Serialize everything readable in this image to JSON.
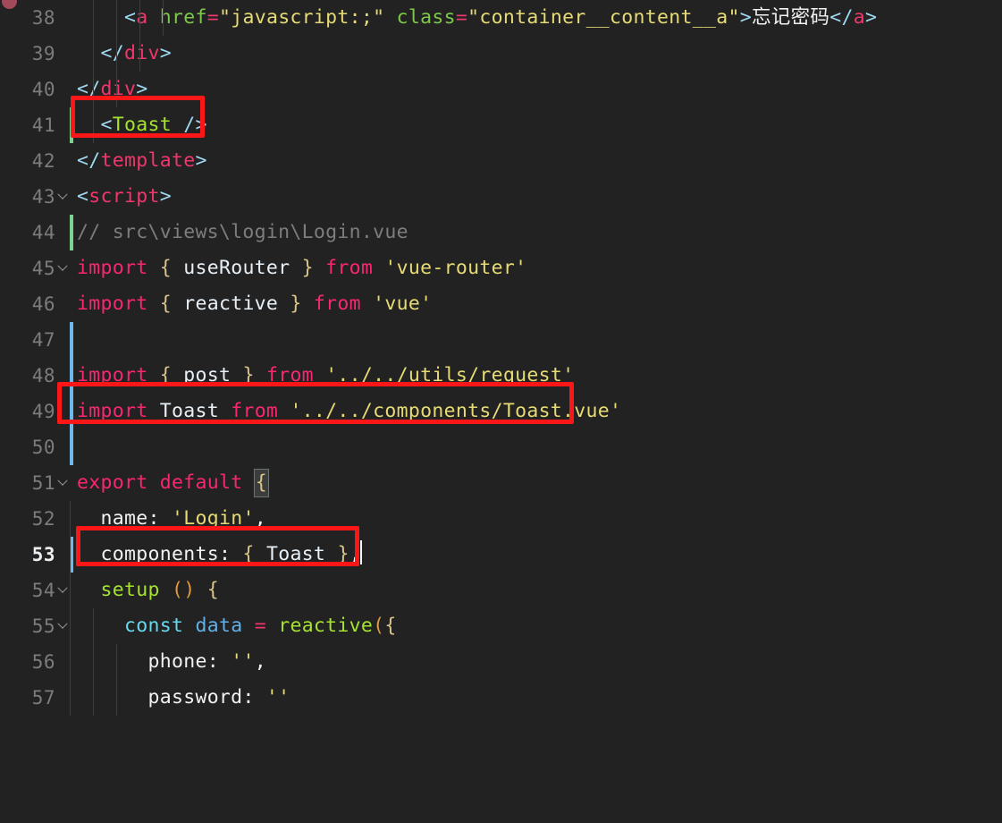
{
  "editor": {
    "background": "#222222",
    "line_number_color": "#7c7c7c",
    "active_line_number": 53,
    "font_size_px": 21.5,
    "annotation_color": "#fb1717",
    "change_marker_green": "#7fd18e",
    "change_marker_blue": "#6fb8ec"
  },
  "gutter": {
    "breakpoint_icon": "breakpoint-dot",
    "fold_icon": "chevron-down-icon"
  },
  "lines": [
    {
      "number": "38",
      "fold": false,
      "marker": "none",
      "text": "      <a href=\"javascript:;\" class=\"container__content__a\">忘记密码</a>"
    },
    {
      "number": "39",
      "fold": false,
      "marker": "none",
      "text": "    </div>"
    },
    {
      "number": "40",
      "fold": false,
      "marker": "none",
      "text": "  </div>"
    },
    {
      "number": "41",
      "fold": false,
      "marker": "green",
      "text": "  <Toast />"
    },
    {
      "number": "42",
      "fold": false,
      "marker": "none",
      "text": "</template>"
    },
    {
      "number": "43",
      "fold": true,
      "marker": "none",
      "text": "<script>"
    },
    {
      "number": "44",
      "fold": false,
      "marker": "green",
      "text": "// src\\views\\login\\Login.vue"
    },
    {
      "number": "45",
      "fold": true,
      "marker": "none",
      "text": "import { useRouter } from 'vue-router'"
    },
    {
      "number": "46",
      "fold": false,
      "marker": "none",
      "text": "import { reactive } from 'vue'"
    },
    {
      "number": "47",
      "fold": false,
      "marker": "blue",
      "text": ""
    },
    {
      "number": "48",
      "fold": false,
      "marker": "blue",
      "text": "import { post } from '../../utils/request'"
    },
    {
      "number": "49",
      "fold": false,
      "marker": "blue",
      "text": "import Toast from '../../components/Toast.vue'"
    },
    {
      "number": "50",
      "fold": false,
      "marker": "blue",
      "text": ""
    },
    {
      "number": "51",
      "fold": true,
      "marker": "none",
      "text": "export default {"
    },
    {
      "number": "52",
      "fold": false,
      "marker": "none",
      "text": "  name: 'Login',"
    },
    {
      "number": "53",
      "fold": false,
      "marker": "blue",
      "text": "  components: { Toast },"
    },
    {
      "number": "54",
      "fold": true,
      "marker": "none",
      "text": "  setup () {"
    },
    {
      "number": "55",
      "fold": true,
      "marker": "none",
      "text": "    const data = reactive({"
    },
    {
      "number": "56",
      "fold": false,
      "marker": "none",
      "text": "      phone: '',"
    },
    {
      "number": "57",
      "fold": false,
      "marker": "none",
      "text": "      password: ''"
    }
  ],
  "annotations": [
    {
      "label": "toast-component-tag-highlight",
      "line": "41"
    },
    {
      "label": "toast-import-highlight",
      "line": "49"
    },
    {
      "label": "components-registration-highlight",
      "line": "53"
    }
  ]
}
